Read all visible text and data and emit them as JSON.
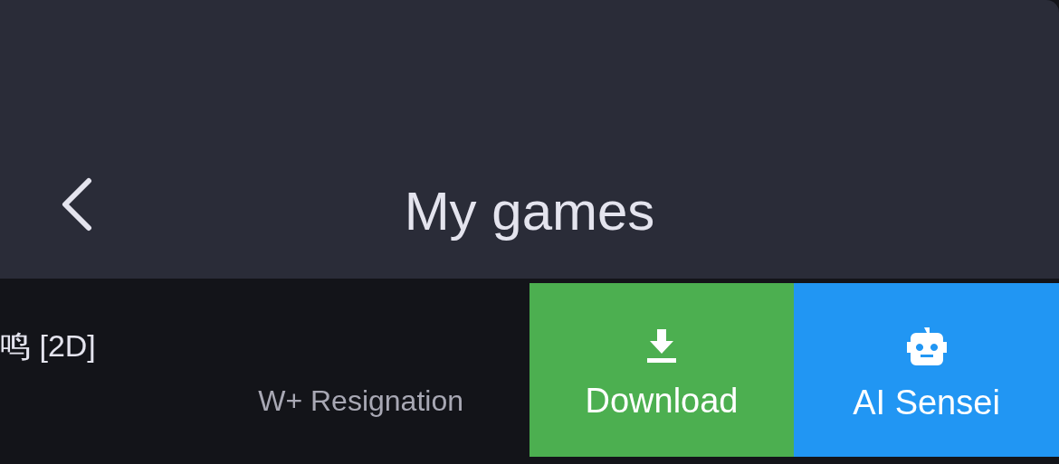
{
  "header": {
    "title": "My games"
  },
  "game_row": {
    "title": "鸣 [2D]",
    "result": "W+ Resignation"
  },
  "actions": [
    {
      "kind": "download",
      "label": "Download",
      "color": "#4caf50"
    },
    {
      "kind": "ai",
      "label": "AI Sensei",
      "color": "#2196f3"
    }
  ]
}
